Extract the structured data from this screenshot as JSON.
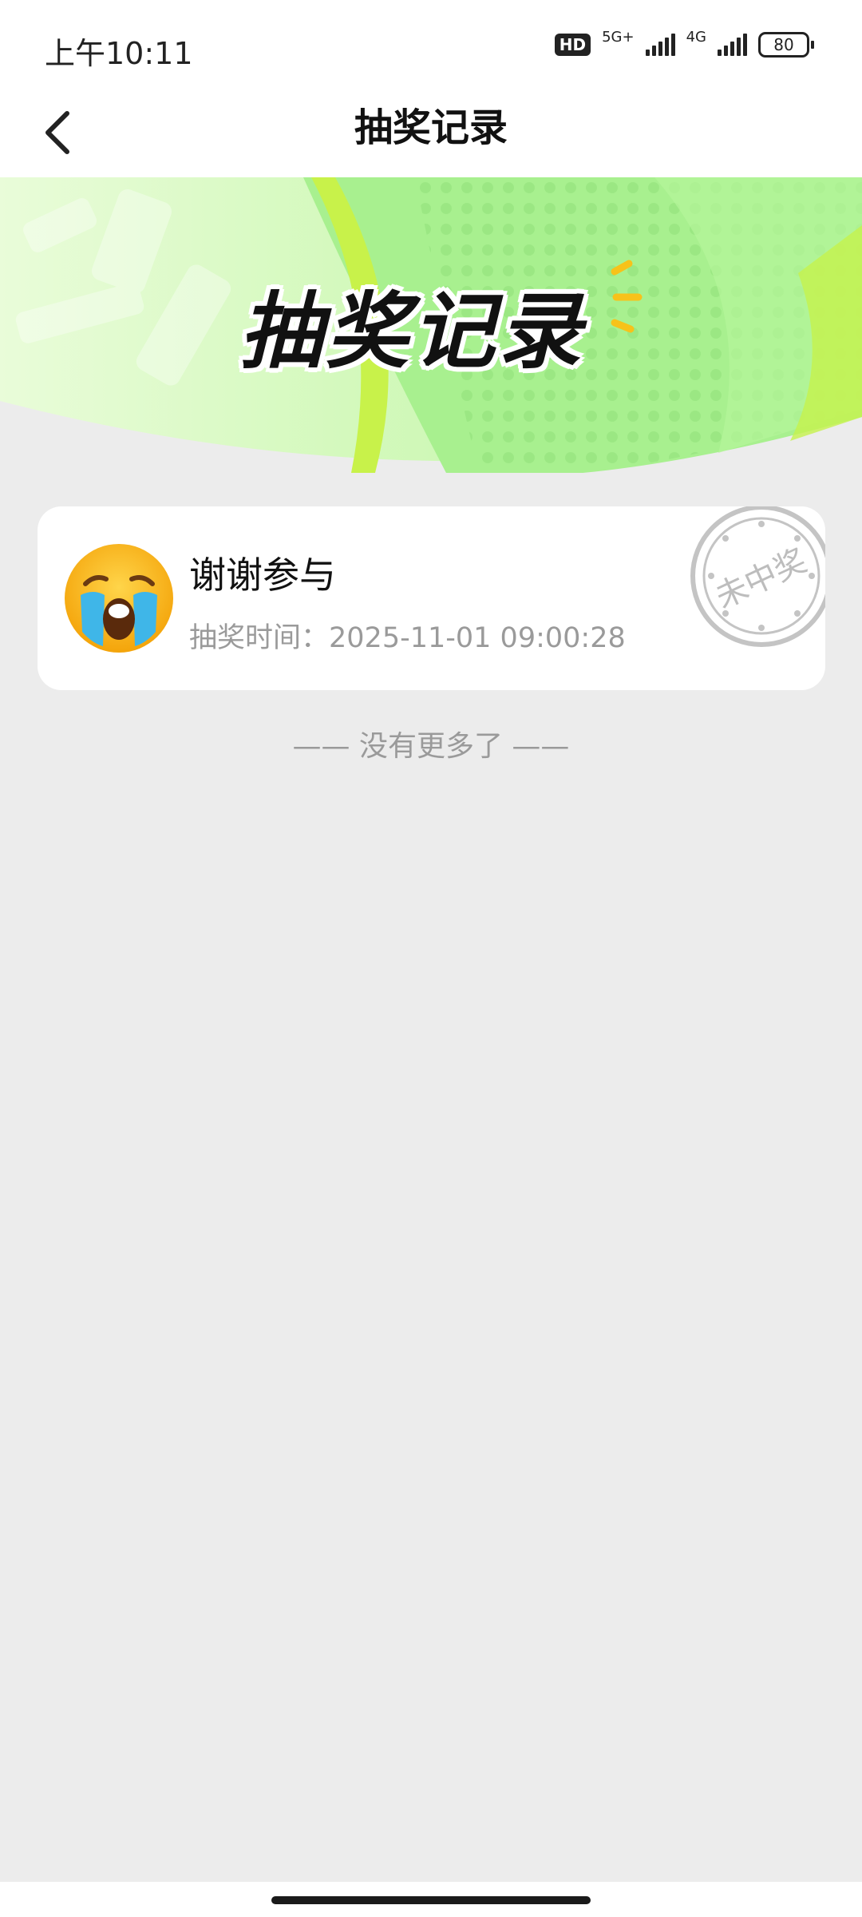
{
  "status_bar": {
    "time": "上午10:11",
    "hd_label": "HD",
    "network_primary": "5G+",
    "network_secondary": "4G",
    "battery": "80"
  },
  "nav": {
    "title": "抽奖记录",
    "back_icon": "chevron-left-icon"
  },
  "banner": {
    "title": "抽奖记录",
    "colors": {
      "light_green": "#d9fbc4",
      "mid_green": "#a6f28a",
      "lime": "#c6f24c",
      "accent_yellow": "#f7c21a"
    }
  },
  "records": [
    {
      "title": "谢谢参与",
      "time_label": "抽奖时间：",
      "time_value": "2025-11-01 09:00:28",
      "stamp_text": "未中奖",
      "icon": "crying-face-emoji"
    }
  ],
  "list_end_text": "—— 没有更多了 ——"
}
